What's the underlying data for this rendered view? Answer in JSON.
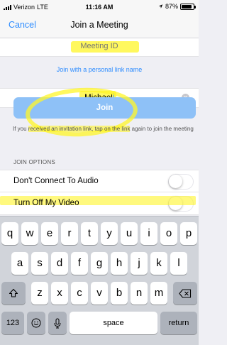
{
  "status_bar": {
    "carrier": "Verizon",
    "network": "LTE",
    "time": "11:16 AM",
    "battery": "87%",
    "battery_level": 0.87
  },
  "nav": {
    "cancel_label": "Cancel",
    "title": "Join a Meeting"
  },
  "meeting_id": {
    "placeholder": "Meeting ID",
    "value": ""
  },
  "personal_link_label": "Join with a personal link name",
  "name_field": {
    "value": "Michael"
  },
  "join_button_label": "Join",
  "help_text": {
    "prefix": "If you ",
    "highlight": "received an invitation link, tap on the link",
    "suffix": " again to join the meeting"
  },
  "options": {
    "header": "JOIN OPTIONS",
    "items": [
      {
        "label": "Don't Connect To Audio",
        "enabled": false
      },
      {
        "label": "Turn Off My Video",
        "enabled": false
      }
    ]
  },
  "keyboard": {
    "row1": [
      "q",
      "w",
      "e",
      "r",
      "t",
      "y",
      "u",
      "i",
      "o",
      "p"
    ],
    "row2": [
      "a",
      "s",
      "d",
      "f",
      "g",
      "h",
      "j",
      "k",
      "l"
    ],
    "row3": [
      "z",
      "x",
      "c",
      "v",
      "b",
      "n",
      "m"
    ],
    "numbers_label": "123",
    "space_label": "space",
    "return_label": "return"
  },
  "colors": {
    "accent": "#2d8cff",
    "join_button": "#8ec1f7",
    "highlight": "#fff528"
  }
}
